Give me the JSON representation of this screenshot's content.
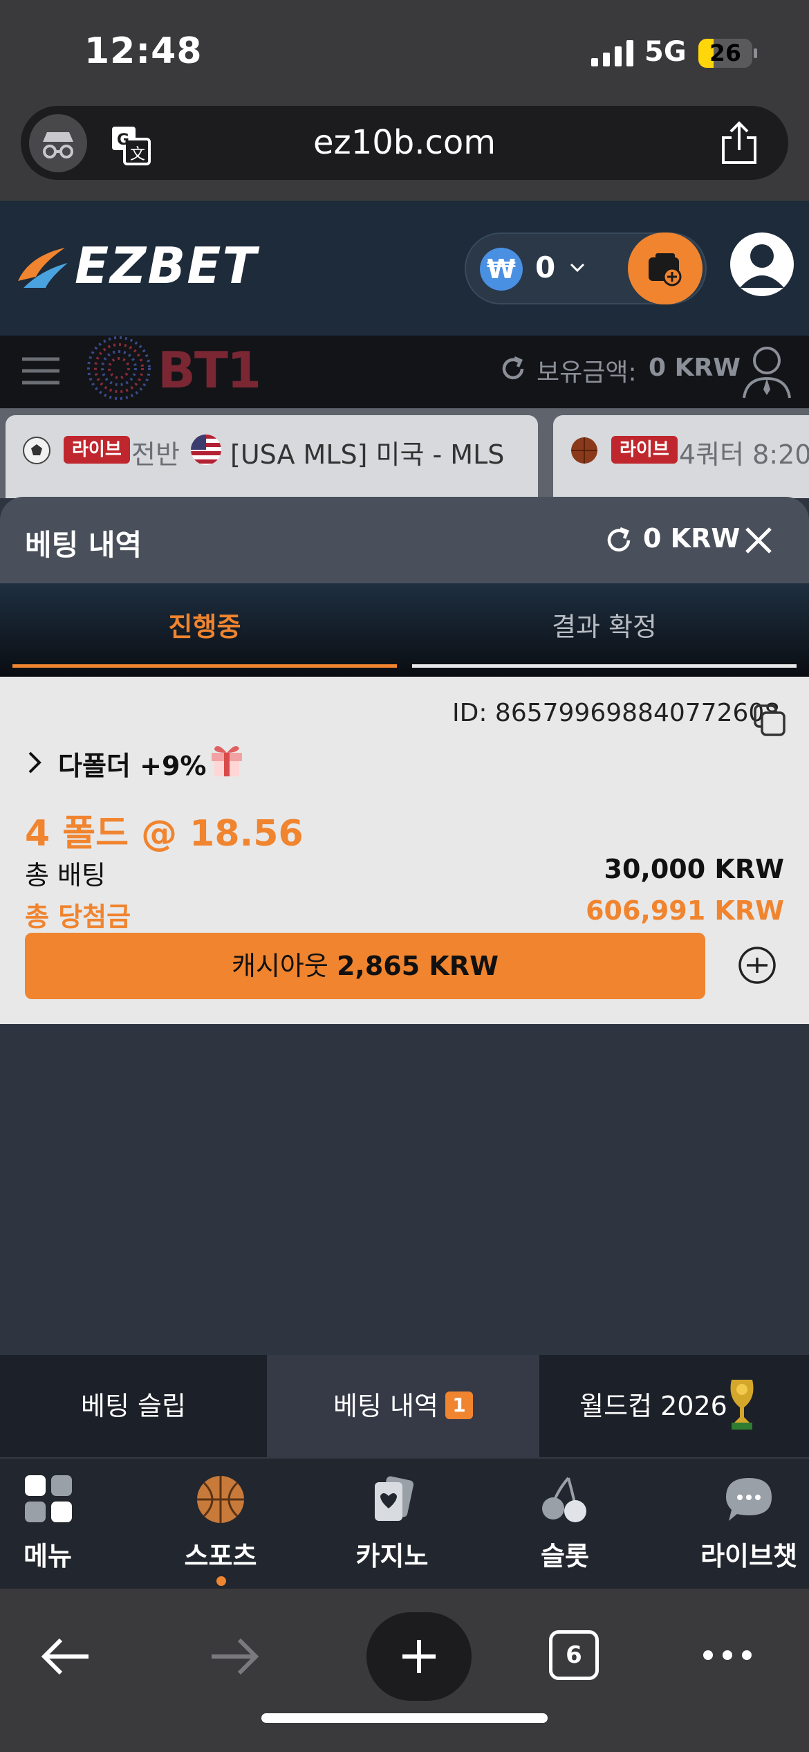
{
  "status_bar": {
    "time": "12:48",
    "network": "5G",
    "battery": "26"
  },
  "browser": {
    "url": "ez10b.com",
    "open_tabs": "6"
  },
  "header": {
    "logo": "EZBET",
    "wallet_balance": "0",
    "currency_symbol": "₩"
  },
  "sub_nav": {
    "sponsor": "BT1",
    "balance_label": "보유금액:",
    "balance_value": "0 KRW"
  },
  "ticker": [
    {
      "badge": "라이브",
      "status": "전반",
      "league": "[USA MLS] 미국 - MLS"
    },
    {
      "badge": "라이브",
      "status": "4쿼터 8:20"
    }
  ],
  "panel": {
    "title": "베팅 내역",
    "balance": "0 KRW"
  },
  "tabs": {
    "active": "진행중",
    "settled": "결과 확정"
  },
  "bet": {
    "id": "ID: 865799698840772608",
    "bonus": "다폴더 +9%",
    "fold_odds": "4 폴드 @  18.56",
    "total_bet_label": "총 배팅",
    "total_bet_value": "30,000 KRW",
    "total_win_label": "총 당첨금",
    "total_win_value": "606,991 KRW",
    "cashout_label": "캐시아웃",
    "cashout_value": "2,865 KRW"
  },
  "slip_tabs": {
    "slip": "베팅 슬립",
    "history": "베팅 내역",
    "history_count": "1",
    "worldcup": "월드컵 2026"
  },
  "main_nav": [
    {
      "label": "메뉴",
      "icon": "grid-icon"
    },
    {
      "label": "스포츠",
      "icon": "basketball-icon"
    },
    {
      "label": "카지노",
      "icon": "cards-icon"
    },
    {
      "label": "슬롯",
      "icon": "cherry-icon"
    },
    {
      "label": "라이브챗",
      "icon": "chat-icon"
    }
  ],
  "colors": {
    "accent": "#f0842f",
    "live": "#c0262d",
    "header_bg": "#1d2b3a"
  }
}
